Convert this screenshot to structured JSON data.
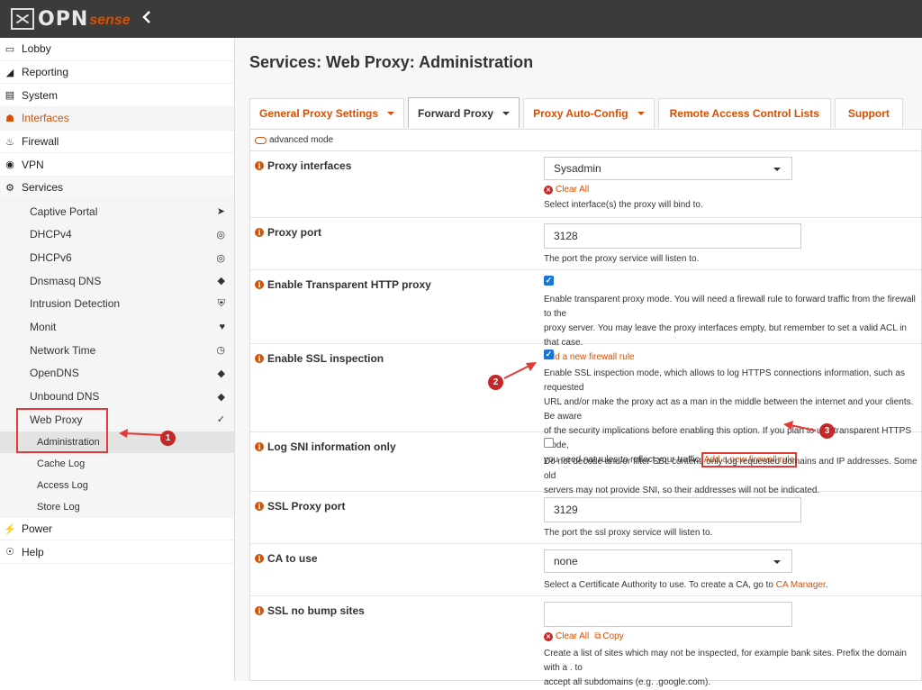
{
  "brand": {
    "logo_main": "OPN",
    "logo_sub": "sense",
    "collapse_icon": "chevron-left"
  },
  "sidebar": {
    "items": [
      {
        "label": "Lobby",
        "icon": "laptop-icon"
      },
      {
        "label": "Reporting",
        "icon": "chart-icon"
      },
      {
        "label": "System",
        "icon": "server-icon"
      },
      {
        "label": "Interfaces",
        "icon": "sitemap-icon"
      },
      {
        "label": "Firewall",
        "icon": "fire-icon"
      },
      {
        "label": "VPN",
        "icon": "globe-icon"
      },
      {
        "label": "Services",
        "icon": "gear-icon"
      }
    ],
    "services": [
      {
        "label": "Captive Portal",
        "icon": "paper-plane-icon"
      },
      {
        "label": "DHCPv4",
        "icon": "bullseye-icon"
      },
      {
        "label": "DHCPv6",
        "icon": "bullseye-icon"
      },
      {
        "label": "Dnsmasq DNS",
        "icon": "tags-icon"
      },
      {
        "label": "Intrusion Detection",
        "icon": "shield-icon"
      },
      {
        "label": "Monit",
        "icon": "heartbeat-icon"
      },
      {
        "label": "Network Time",
        "icon": "clock-icon"
      },
      {
        "label": "OpenDNS",
        "icon": "tags-icon"
      },
      {
        "label": "Unbound DNS",
        "icon": "tags-icon"
      },
      {
        "label": "Web Proxy",
        "icon": "bolt-icon"
      }
    ],
    "webproxy": [
      "Administration",
      "Cache Log",
      "Access Log",
      "Store Log"
    ],
    "bottom": [
      {
        "label": "Power",
        "icon": "plug-icon"
      },
      {
        "label": "Help",
        "icon": "help-icon"
      }
    ]
  },
  "page": {
    "title": "Services: Web Proxy: Administration"
  },
  "tabs": [
    {
      "label": "General Proxy Settings",
      "dropdown": true
    },
    {
      "label": "Forward Proxy",
      "dropdown": true
    },
    {
      "label": "Proxy Auto-Config",
      "dropdown": true
    },
    {
      "label": "Remote Access Control Lists",
      "dropdown": false
    },
    {
      "label": "Support",
      "dropdown": false
    }
  ],
  "form": {
    "advanced_mode": "advanced mode",
    "proxy_interfaces": {
      "label": "Proxy interfaces",
      "value": "Sysadmin",
      "clear": "Clear All",
      "help": "Select interface(s) the proxy will bind to."
    },
    "proxy_port": {
      "label": "Proxy port",
      "value": "3128",
      "help": "The port the proxy service will listen to."
    },
    "transparent": {
      "label": "Enable Transparent HTTP proxy",
      "checked": true,
      "help1": "Enable transparent proxy mode. You will need a firewall rule to forward traffic from the firewall to the",
      "help2": "proxy server. You may leave the proxy interfaces empty, but remember to set a valid ACL in that case.",
      "link": "Add a new firewall rule"
    },
    "ssl": {
      "label": "Enable SSL inspection",
      "checked": true,
      "help1": "Enable SSL inspection mode, which allows to log HTTPS connections information, such as requested",
      "help2": "URL and/or make the proxy act as a man in the middle between the internet and your clients. Be aware",
      "help3": "of the security implications before enabling this option. If you plan to use transparent HTTPS mode,",
      "help4": "you need nat rules to reflect your traffic.",
      "link": "Add a new firewall rule"
    },
    "sni": {
      "label": "Log SNI information only",
      "checked": false,
      "help1": "Do not decode and/or filter SSL content, only log requested domains and IP addresses. Some old",
      "help2": "servers may not provide SNI, so their addresses will not be indicated."
    },
    "ssl_port": {
      "label": "SSL Proxy port",
      "value": "3129",
      "help": "The port the ssl proxy service will listen to."
    },
    "ca": {
      "label": "CA to use",
      "value": "none",
      "help": "Select a Certificate Authority to use. To create a CA, go to",
      "link": "CA Manager",
      "help_end": "."
    },
    "nobump": {
      "label": "SSL no bump sites",
      "value": "",
      "clear": "Clear All",
      "copy": "Copy",
      "help1": "Create a list of sites which may not be inspected, for example bank sites. Prefix the domain with a . to",
      "help2": "accept all subdomains (e.g. .google.com)."
    }
  },
  "annotations": [
    "1",
    "2",
    "3"
  ],
  "colors": {
    "accent": "#d94f00",
    "marker": "#e53935",
    "topbar": "#3b3b3b"
  }
}
